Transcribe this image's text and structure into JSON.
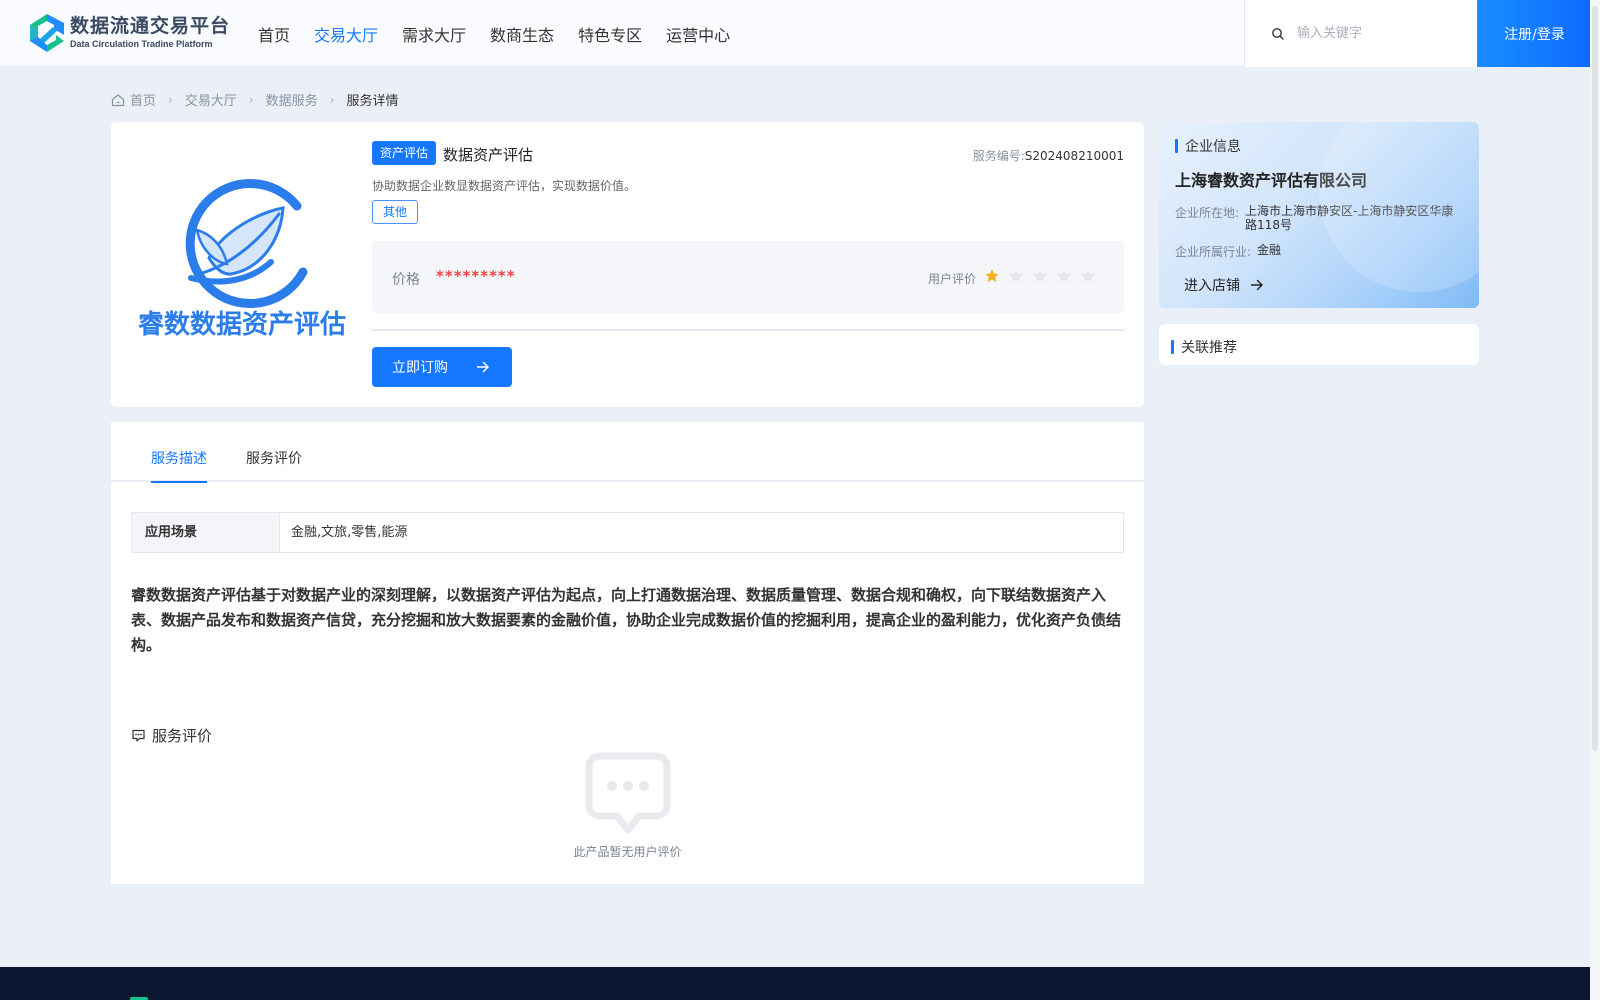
{
  "header": {
    "logo_cn": "数据流通交易平台",
    "logo_en": "Data Circulation Tradine Platform",
    "nav": [
      "首页",
      "交易大厅",
      "需求大厅",
      "数商生态",
      "特色专区",
      "运营中心"
    ],
    "active_nav": "交易大厅",
    "search_placeholder": "输入关键字",
    "login_label": "注册/登录"
  },
  "breadcrumb": [
    "首页",
    "交易大厅",
    "数据服务",
    "服务详情"
  ],
  "product": {
    "logo_caption": "睿数数据资产评估",
    "category_tag": "资产评估",
    "title": "数据资产评估",
    "service_no_label": "服务编号:",
    "service_no": "S202408210001",
    "description": "协助数据企业数显数据资产评估，实现数据价值。",
    "tag": "其他",
    "price_label": "价格",
    "price_value": "*********",
    "rating_label": "用户评价",
    "rating": 1,
    "rating_max": 5,
    "buy_label": "立即订购"
  },
  "tabs": [
    "服务描述",
    "服务评价"
  ],
  "active_tab": "服务描述",
  "scene": {
    "label": "应用场景",
    "value": "金融,文旅,零售,能源"
  },
  "detail_text": "睿数数据资产评估基于对数据产业的深刻理解，以数据资产评估为起点，向上打通数据治理、数据质量管理、数据合规和确权，向下联结数据资产入表、数据产品发布和数据资产信贷，充分挖掘和放大数据要素的金融价值，协助企业完成数据价值的挖掘利用，提高企业的盈利能力，优化资产负债结构。",
  "reviews": {
    "heading": "服务评价",
    "empty_text": "此产品暂无用户评价"
  },
  "company": {
    "heading": "企业信息",
    "name": "上海睿数资产评估有限公司",
    "location_label": "企业所在地:",
    "location": "上海市上海市静安区-上海市静安区华康路118号",
    "industry_label": "企业所属行业:",
    "industry": "金融",
    "shop_label": "进入店铺"
  },
  "related": {
    "heading": "关联推荐"
  },
  "colors": {
    "primary": "#1677ff",
    "price": "#f04545",
    "star_on": "#f5b021",
    "star_off": "#e4e7ec",
    "footer": "#0c1731"
  }
}
